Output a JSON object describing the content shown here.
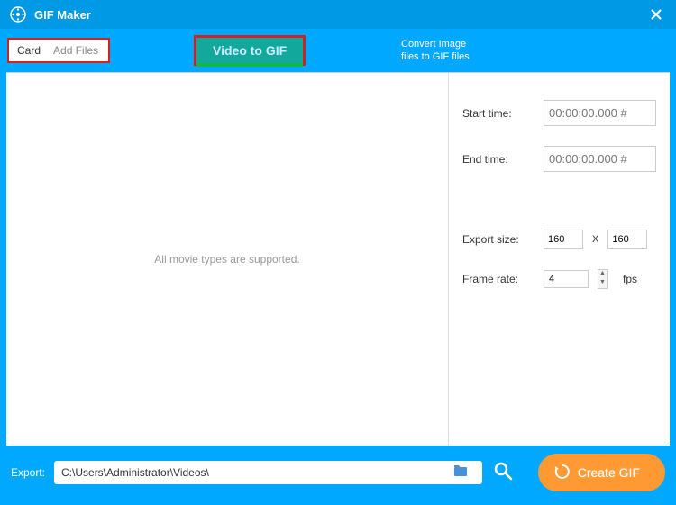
{
  "titlebar": {
    "title": "GIF Maker"
  },
  "toolbar": {
    "card_label": "Card",
    "addfiles_label": "Add Files",
    "tab_video_label": "Video to GIF",
    "convert_info_line1": "Convert Image",
    "convert_info_line2": "files to GIF files"
  },
  "dropzone": {
    "message": "All movie types are supported."
  },
  "settings": {
    "start_time_label": "Start time:",
    "start_time_value": "00:00:00.000 #",
    "end_time_label": "End time:",
    "end_time_value": "00:00:00.000 #",
    "export_size_label": "Export size:",
    "width_value": "160",
    "size_separator": "X",
    "height_value": "160",
    "frame_rate_label": "Frame rate:",
    "frame_rate_value": "4",
    "fps_label": "fps"
  },
  "footer": {
    "export_label": "Export:",
    "path_value": "C:\\Users\\Administrator\\Videos\\",
    "create_label": "Create GIF"
  }
}
